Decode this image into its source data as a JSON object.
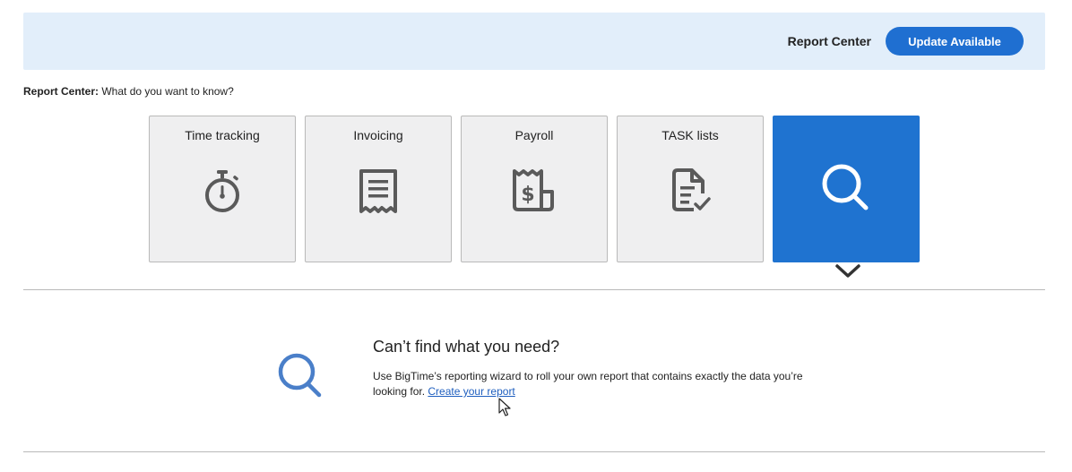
{
  "header": {
    "title": "Report Center",
    "update_button": "Update Available",
    "background_color": "#e2eefa",
    "button_color": "#1f6fd1"
  },
  "subtitle": {
    "label": "Report Center:",
    "text": "What do you want to know?"
  },
  "tiles": [
    {
      "label": "Time tracking",
      "icon": "stopwatch-icon"
    },
    {
      "label": "Invoicing",
      "icon": "receipt-icon"
    },
    {
      "label": "Payroll",
      "icon": "payroll-receipt-icon"
    },
    {
      "label": "TASK lists",
      "icon": "task-document-icon"
    },
    {
      "label": "",
      "icon": "search-icon",
      "selected": true
    }
  ],
  "custom_report": {
    "title": "Can’t find what you need?",
    "text": "Use BigTime’s reporting wizard to roll your own report that contains exactly the data you’re looking for.",
    "link": "Create your report",
    "icon": "search-icon"
  },
  "colors": {
    "accent": "#1f73d0",
    "link": "#1f5fbf",
    "icon_gray": "#5a5a5a",
    "search_icon_blue": "#4a7fc9"
  }
}
